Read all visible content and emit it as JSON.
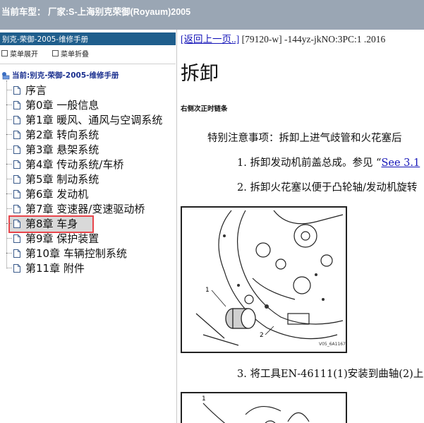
{
  "titlebar": {
    "text": "当前车型：  厂家:S-上海别克荣御(Royaum)2005"
  },
  "left_pane": {
    "header": "别克-荣御-2005-维修手册",
    "tools": {
      "expand": "菜单展开",
      "collapse": "菜单折叠"
    },
    "root": "当前:别克-荣御-2005-维修手册",
    "items": [
      {
        "label": "序言"
      },
      {
        "label": "第0章 一般信息"
      },
      {
        "label": "第1章 暖风、通风与空调系统"
      },
      {
        "label": "第2章 转向系统"
      },
      {
        "label": "第3章 悬架系统"
      },
      {
        "label": "第4章 传动系统/车桥"
      },
      {
        "label": "第5章 制动系统"
      },
      {
        "label": "第6章 发动机"
      },
      {
        "label": "第7章 变速器/变速驱动桥"
      },
      {
        "label": "第8章 车身"
      },
      {
        "label": "第9章 保护装置"
      },
      {
        "label": "第10章 车辆控制系统"
      },
      {
        "label": "第11章 附件"
      }
    ],
    "selected_index": 7
  },
  "content": {
    "back_link": "[返回上一页..]",
    "nav_meta": " [79120-w] -144yz-jkNO:3PC:1 .2016",
    "title": "拆卸",
    "subhead": "右侧次正时链条",
    "note": "特别注意事项：拆卸上进气歧管和火花塞后",
    "step1_prefix": "1. 拆卸发动机前盖总成。参见 “",
    "step1_link": "See 3.1",
    "step2": "2. 拆卸火花塞以便于凸轮轴/发动机旋转",
    "step3": "3. 将工具EN-46111(1)安装到曲轴(2)上",
    "fig1": {
      "callout1": "1",
      "callout2": "2",
      "code": "V05_6A1167"
    },
    "fig2": {
      "callout1": "1"
    }
  },
  "colors": {
    "titlebar": "#9aa6b4",
    "tree_header": "#1f5e8c",
    "selection_border": "#e8454b",
    "link": "#1515b8"
  }
}
